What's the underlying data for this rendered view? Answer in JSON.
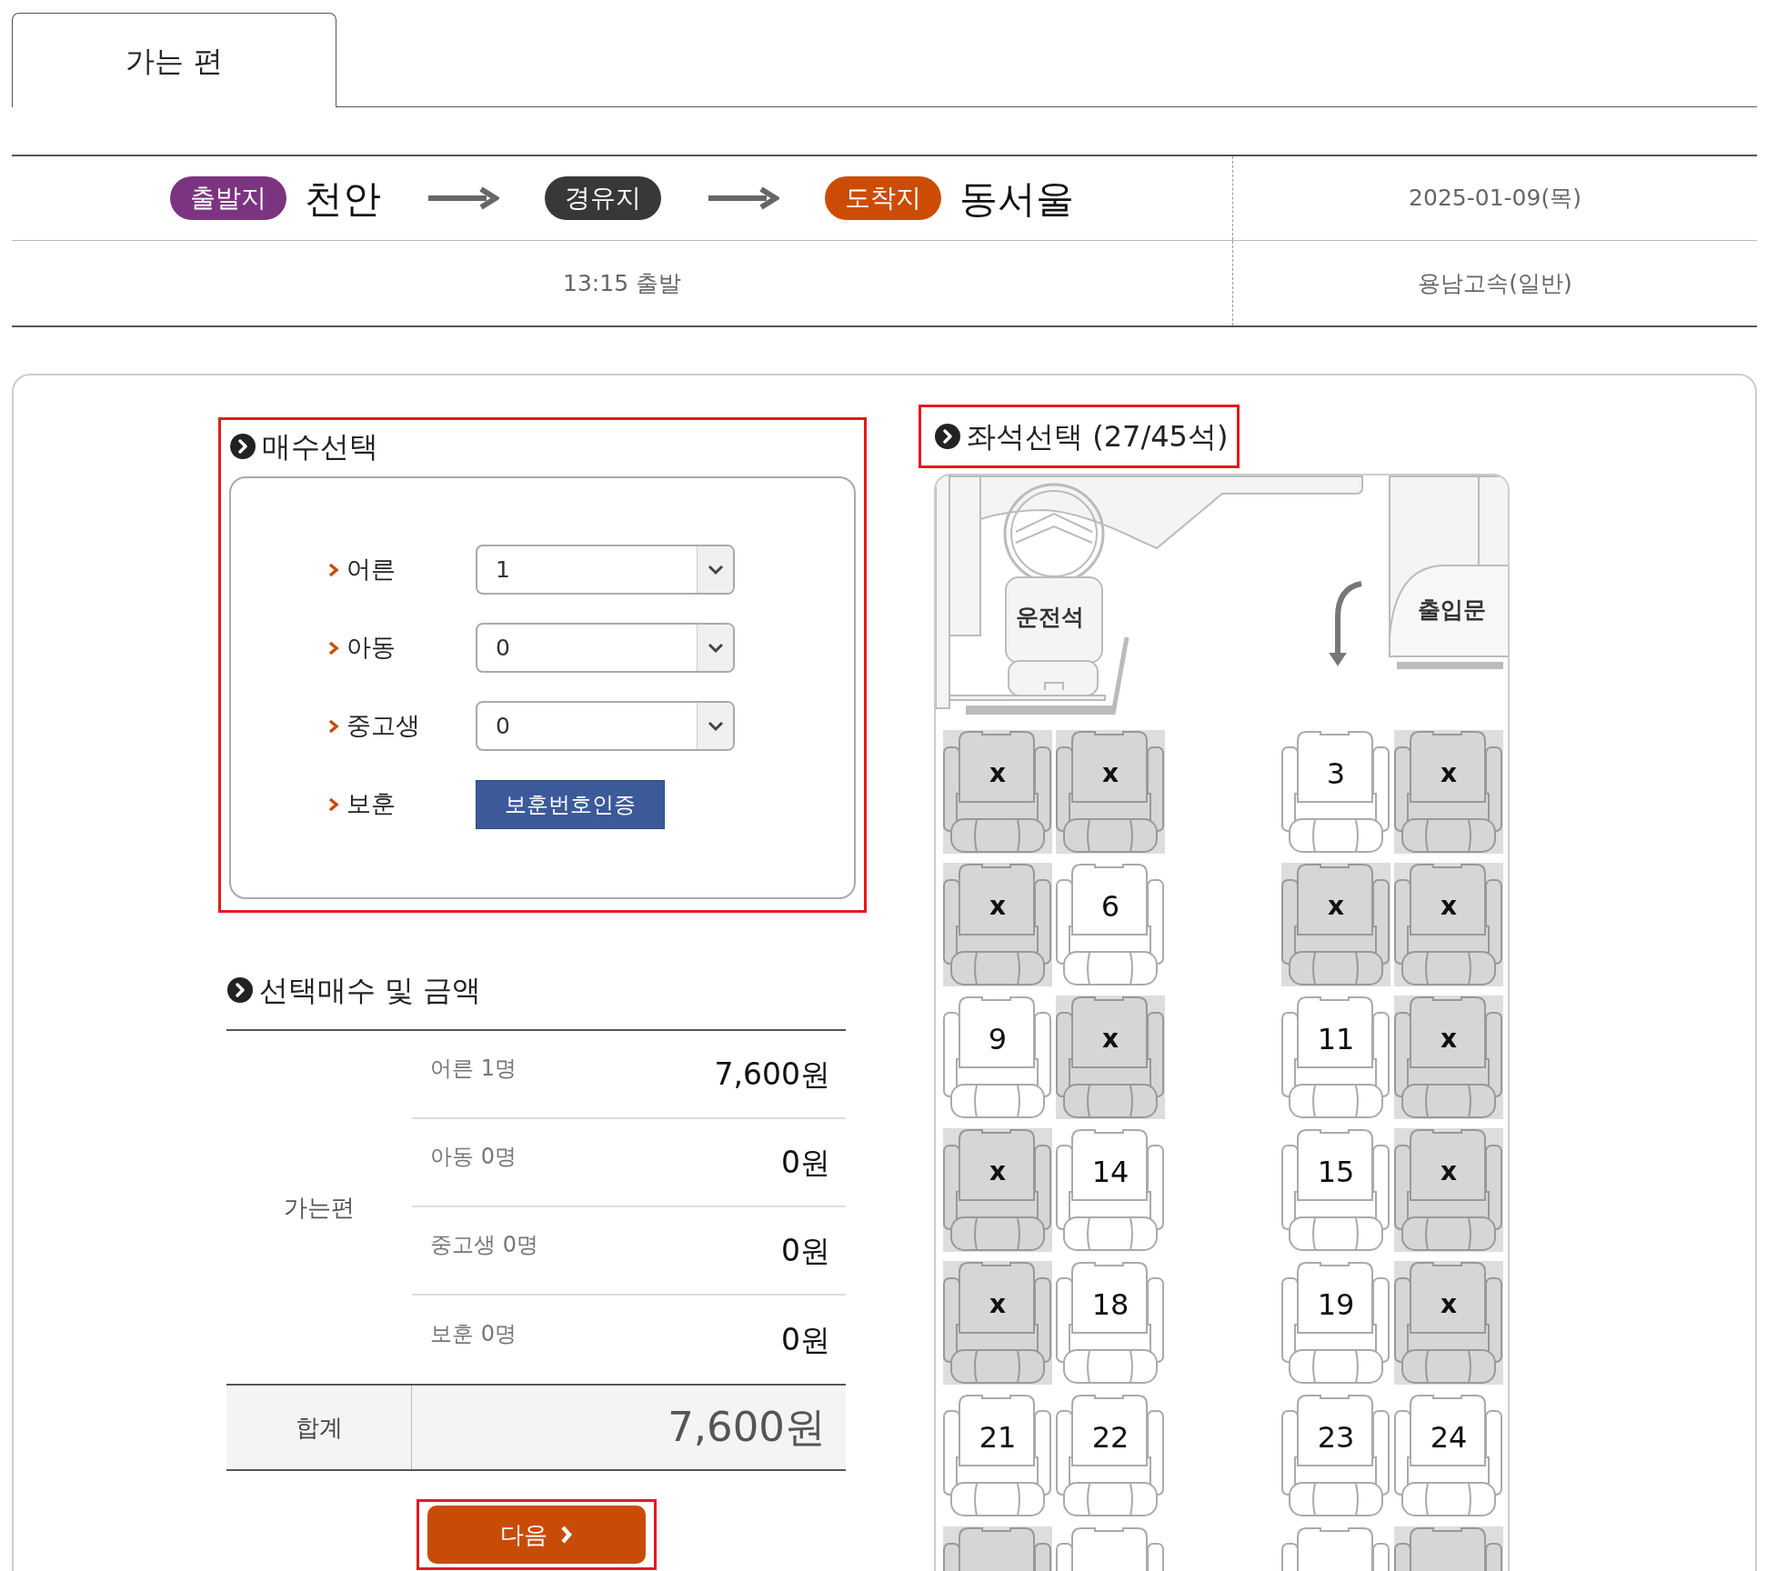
{
  "tabs": [
    {
      "label": "가는 편",
      "selected": true
    }
  ],
  "route": {
    "stops": [
      {
        "tag": "출발지",
        "name": "천안",
        "color": "#7b3480"
      },
      {
        "tag": "경유지",
        "color": "#383838"
      },
      {
        "tag": "도착지",
        "name": "동서울",
        "color": "#cc4c06"
      }
    ],
    "date": "2025-01-09(목)",
    "departure": "13:15 출발",
    "company": "용남고속(일반)"
  },
  "ticket_count": {
    "title": "매수선택",
    "highlighted": true,
    "rows": [
      {
        "kind": "select",
        "label": "어른",
        "value": "1"
      },
      {
        "kind": "select",
        "label": "아동",
        "value": "0"
      },
      {
        "kind": "select",
        "label": "중고생",
        "value": "0"
      },
      {
        "kind": "button",
        "label": "보훈",
        "button": "보훈번호인증"
      }
    ]
  },
  "summary": {
    "title": "선택매수 및 금액",
    "group": "가는편",
    "items": [
      {
        "label": "어른 1명",
        "amount": "7,600원"
      },
      {
        "label": "아동 0명",
        "amount": "0원"
      },
      {
        "label": "중고생 0명",
        "amount": "0원"
      },
      {
        "label": "보훈 0명",
        "amount": "0원"
      }
    ],
    "total": {
      "label": "합계",
      "amount": "7,600원"
    }
  },
  "next_button": {
    "label": "다음",
    "highlighted": true
  },
  "seat_selection": {
    "title": "좌석선택 (27/45석)",
    "highlighted": true,
    "driver_label": "운전석",
    "door_label": "출입문",
    "rows": [
      {
        "seats": [
          {
            "label": "x",
            "sold": true
          },
          {
            "label": "x",
            "sold": true
          },
          {
            "label": "3",
            "sold": false
          },
          {
            "label": "x",
            "sold": true
          }
        ]
      },
      {
        "seats": [
          {
            "label": "x",
            "sold": true
          },
          {
            "label": "6",
            "sold": false
          },
          {
            "label": "x",
            "sold": true
          },
          {
            "label": "x",
            "sold": true
          }
        ]
      },
      {
        "seats": [
          {
            "label": "9",
            "sold": false
          },
          {
            "label": "x",
            "sold": true
          },
          {
            "label": "11",
            "sold": false
          },
          {
            "label": "x",
            "sold": true
          }
        ]
      },
      {
        "seats": [
          {
            "label": "x",
            "sold": true
          },
          {
            "label": "14",
            "sold": false
          },
          {
            "label": "15",
            "sold": false
          },
          {
            "label": "x",
            "sold": true
          }
        ]
      },
      {
        "seats": [
          {
            "label": "x",
            "sold": true
          },
          {
            "label": "18",
            "sold": false
          },
          {
            "label": "19",
            "sold": false
          },
          {
            "label": "x",
            "sold": true
          }
        ]
      },
      {
        "seats": [
          {
            "label": "21",
            "sold": false
          },
          {
            "label": "22",
            "sold": false
          },
          {
            "label": "23",
            "sold": false
          },
          {
            "label": "24",
            "sold": false
          }
        ]
      },
      {
        "seats": [
          {
            "sold": true
          },
          {
            "sold": false
          },
          {
            "sold": false
          },
          {
            "sold": true
          }
        ]
      }
    ]
  }
}
